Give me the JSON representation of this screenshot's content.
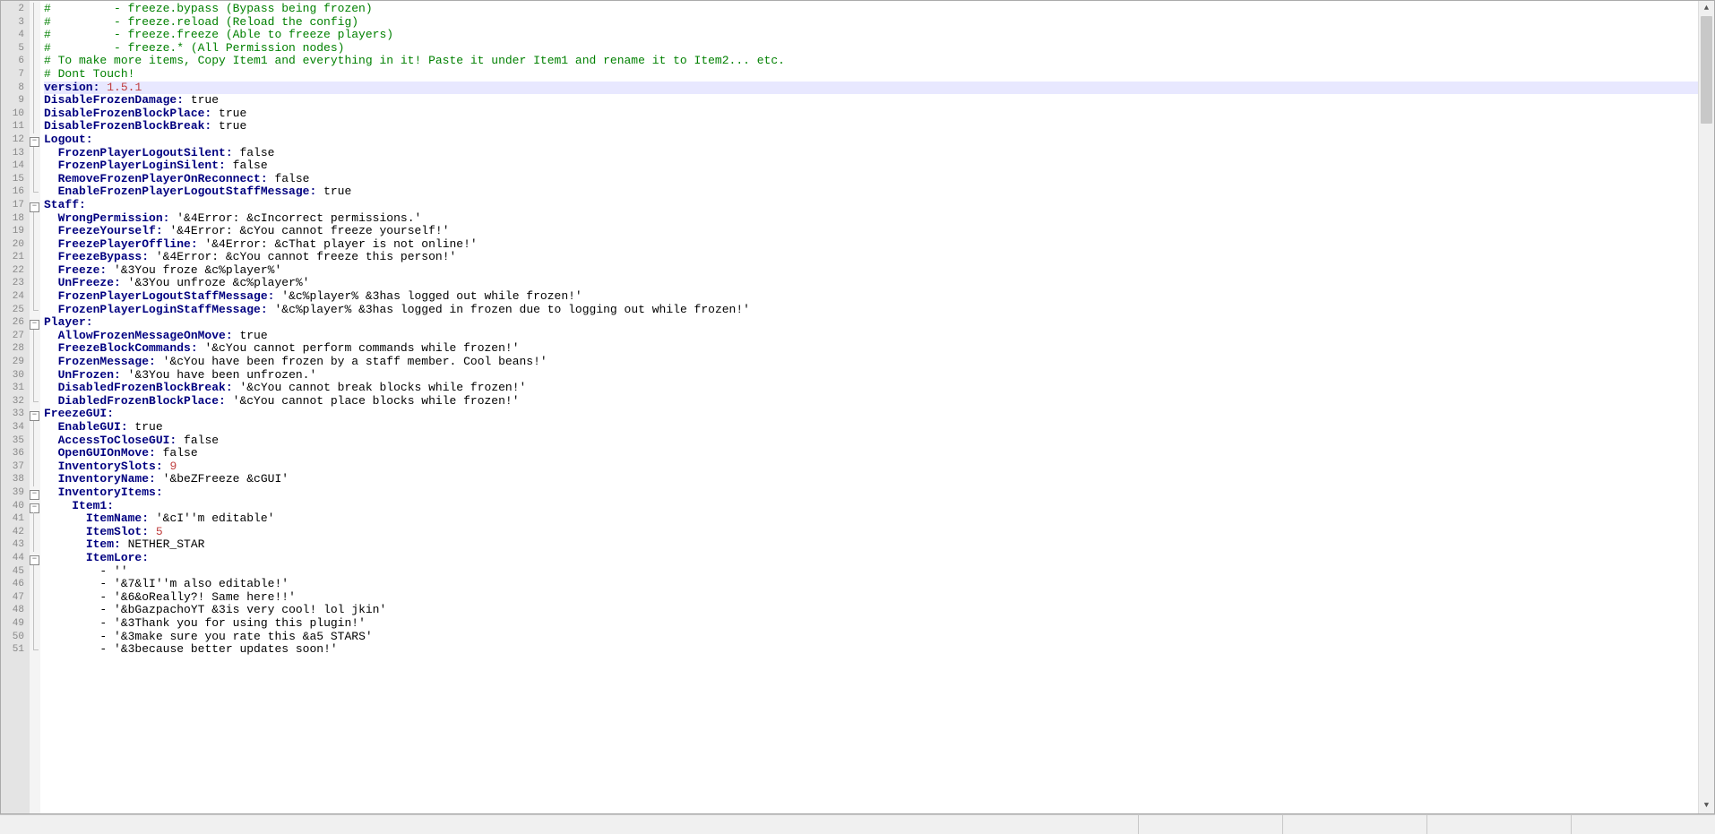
{
  "chart_data": null,
  "lines": [
    {
      "num": 2,
      "fold": "line",
      "segs": [
        {
          "cls": "c-comment",
          "t": "#         - freeze.bypass (Bypass being frozen)"
        }
      ]
    },
    {
      "num": 3,
      "fold": "line",
      "segs": [
        {
          "cls": "c-comment",
          "t": "#         - freeze.reload (Reload the config)"
        }
      ]
    },
    {
      "num": 4,
      "fold": "line",
      "segs": [
        {
          "cls": "c-comment",
          "t": "#         - freeze.freeze (Able to freeze players)"
        }
      ]
    },
    {
      "num": 5,
      "fold": "line",
      "segs": [
        {
          "cls": "c-comment",
          "t": "#         - freeze.* (All Permission nodes)"
        }
      ]
    },
    {
      "num": 6,
      "fold": "line",
      "segs": [
        {
          "cls": "c-comment",
          "t": "# To make more items, Copy Item1 and everything in it! Paste it under Item1 and rename it to Item2... etc."
        }
      ]
    },
    {
      "num": 7,
      "fold": "line",
      "segs": [
        {
          "cls": "c-comment",
          "t": "# Dont Touch!"
        }
      ]
    },
    {
      "num": 8,
      "fold": "line",
      "hl": true,
      "segs": [
        {
          "cls": "c-key",
          "t": "version:"
        },
        {
          "cls": "c-plain",
          "t": " "
        },
        {
          "cls": "c-num",
          "t": "1.5.1"
        }
      ]
    },
    {
      "num": 9,
      "fold": "line",
      "segs": [
        {
          "cls": "c-key",
          "t": "DisableFrozenDamage:"
        },
        {
          "cls": "c-plain",
          "t": " true"
        }
      ]
    },
    {
      "num": 10,
      "fold": "line",
      "segs": [
        {
          "cls": "c-key",
          "t": "DisableFrozenBlockPlace:"
        },
        {
          "cls": "c-plain",
          "t": " true"
        }
      ]
    },
    {
      "num": 11,
      "fold": "line",
      "segs": [
        {
          "cls": "c-key",
          "t": "DisableFrozenBlockBreak:"
        },
        {
          "cls": "c-plain",
          "t": " true"
        }
      ]
    },
    {
      "num": 12,
      "fold": "open",
      "segs": [
        {
          "cls": "c-key",
          "t": "Logout:"
        }
      ]
    },
    {
      "num": 13,
      "fold": "line",
      "indent": 1,
      "segs": [
        {
          "cls": "c-key",
          "t": "FrozenPlayerLogoutSilent:"
        },
        {
          "cls": "c-plain",
          "t": " false"
        }
      ]
    },
    {
      "num": 14,
      "fold": "line",
      "indent": 1,
      "segs": [
        {
          "cls": "c-key",
          "t": "FrozenPlayerLoginSilent:"
        },
        {
          "cls": "c-plain",
          "t": " false"
        }
      ]
    },
    {
      "num": 15,
      "fold": "line",
      "indent": 1,
      "segs": [
        {
          "cls": "c-key",
          "t": "RemoveFrozenPlayerOnReconnect:"
        },
        {
          "cls": "c-plain",
          "t": " false"
        }
      ]
    },
    {
      "num": 16,
      "fold": "end",
      "indent": 1,
      "segs": [
        {
          "cls": "c-key",
          "t": "EnableFrozenPlayerLogoutStaffMessage:"
        },
        {
          "cls": "c-plain",
          "t": " true"
        }
      ]
    },
    {
      "num": 17,
      "fold": "open",
      "segs": [
        {
          "cls": "c-key",
          "t": "Staff:"
        }
      ]
    },
    {
      "num": 18,
      "fold": "line",
      "indent": 1,
      "segs": [
        {
          "cls": "c-key",
          "t": "WrongPermission:"
        },
        {
          "cls": "c-plain",
          "t": " "
        },
        {
          "cls": "c-str",
          "t": "'&4Error: &cIncorrect permissions.'"
        }
      ]
    },
    {
      "num": 19,
      "fold": "line",
      "indent": 1,
      "segs": [
        {
          "cls": "c-key",
          "t": "FreezeYourself:"
        },
        {
          "cls": "c-plain",
          "t": " "
        },
        {
          "cls": "c-str",
          "t": "'&4Error: &cYou cannot freeze yourself!'"
        }
      ]
    },
    {
      "num": 20,
      "fold": "line",
      "indent": 1,
      "segs": [
        {
          "cls": "c-key",
          "t": "FreezePlayerOffline:"
        },
        {
          "cls": "c-plain",
          "t": " "
        },
        {
          "cls": "c-str",
          "t": "'&4Error: &cThat player is not online!'"
        }
      ]
    },
    {
      "num": 21,
      "fold": "line",
      "indent": 1,
      "segs": [
        {
          "cls": "c-key",
          "t": "FreezeBypass:"
        },
        {
          "cls": "c-plain",
          "t": " "
        },
        {
          "cls": "c-str",
          "t": "'&4Error: &cYou cannot freeze this person!'"
        }
      ]
    },
    {
      "num": 22,
      "fold": "line",
      "indent": 1,
      "segs": [
        {
          "cls": "c-key",
          "t": "Freeze:"
        },
        {
          "cls": "c-plain",
          "t": " "
        },
        {
          "cls": "c-str",
          "t": "'&3You froze &c%player%'"
        }
      ]
    },
    {
      "num": 23,
      "fold": "line",
      "indent": 1,
      "segs": [
        {
          "cls": "c-key",
          "t": "UnFreeze:"
        },
        {
          "cls": "c-plain",
          "t": " "
        },
        {
          "cls": "c-str",
          "t": "'&3You unfroze &c%player%'"
        }
      ]
    },
    {
      "num": 24,
      "fold": "line",
      "indent": 1,
      "segs": [
        {
          "cls": "c-key",
          "t": "FrozenPlayerLogoutStaffMessage:"
        },
        {
          "cls": "c-plain",
          "t": " "
        },
        {
          "cls": "c-str",
          "t": "'&c%player% &3has logged out while frozen!'"
        }
      ]
    },
    {
      "num": 25,
      "fold": "end",
      "indent": 1,
      "segs": [
        {
          "cls": "c-key",
          "t": "FrozenPlayerLoginStaffMessage:"
        },
        {
          "cls": "c-plain",
          "t": " "
        },
        {
          "cls": "c-str",
          "t": "'&c%player% &3has logged in frozen due to logging out while frozen!'"
        }
      ]
    },
    {
      "num": 26,
      "fold": "open",
      "segs": [
        {
          "cls": "c-key",
          "t": "Player:"
        }
      ]
    },
    {
      "num": 27,
      "fold": "line",
      "indent": 1,
      "segs": [
        {
          "cls": "c-key",
          "t": "AllowFrozenMessageOnMove:"
        },
        {
          "cls": "c-plain",
          "t": " true"
        }
      ]
    },
    {
      "num": 28,
      "fold": "line",
      "indent": 1,
      "segs": [
        {
          "cls": "c-key",
          "t": "FreezeBlockCommands:"
        },
        {
          "cls": "c-plain",
          "t": " "
        },
        {
          "cls": "c-str",
          "t": "'&cYou cannot perform commands while frozen!'"
        }
      ]
    },
    {
      "num": 29,
      "fold": "line",
      "indent": 1,
      "segs": [
        {
          "cls": "c-key",
          "t": "FrozenMessage:"
        },
        {
          "cls": "c-plain",
          "t": " "
        },
        {
          "cls": "c-str",
          "t": "'&cYou have been frozen by a staff member. Cool beans!'"
        }
      ]
    },
    {
      "num": 30,
      "fold": "line",
      "indent": 1,
      "segs": [
        {
          "cls": "c-key",
          "t": "UnFrozen:"
        },
        {
          "cls": "c-plain",
          "t": " "
        },
        {
          "cls": "c-str",
          "t": "'&3You have been unfrozen.'"
        }
      ]
    },
    {
      "num": 31,
      "fold": "line",
      "indent": 1,
      "segs": [
        {
          "cls": "c-key",
          "t": "DisabledFrozenBlockBreak:"
        },
        {
          "cls": "c-plain",
          "t": " "
        },
        {
          "cls": "c-str",
          "t": "'&cYou cannot break blocks while frozen!'"
        }
      ]
    },
    {
      "num": 32,
      "fold": "end",
      "indent": 1,
      "segs": [
        {
          "cls": "c-key",
          "t": "DiabledFrozenBlockPlace:"
        },
        {
          "cls": "c-plain",
          "t": " "
        },
        {
          "cls": "c-str",
          "t": "'&cYou cannot place blocks while frozen!'"
        }
      ]
    },
    {
      "num": 33,
      "fold": "open",
      "segs": [
        {
          "cls": "c-key",
          "t": "FreezeGUI:"
        }
      ]
    },
    {
      "num": 34,
      "fold": "line",
      "indent": 1,
      "segs": [
        {
          "cls": "c-key",
          "t": "EnableGUI:"
        },
        {
          "cls": "c-plain",
          "t": " true"
        }
      ]
    },
    {
      "num": 35,
      "fold": "line",
      "indent": 1,
      "segs": [
        {
          "cls": "c-key",
          "t": "AccessToCloseGUI:"
        },
        {
          "cls": "c-plain",
          "t": " false"
        }
      ]
    },
    {
      "num": 36,
      "fold": "line",
      "indent": 1,
      "segs": [
        {
          "cls": "c-key",
          "t": "OpenGUIOnMove:"
        },
        {
          "cls": "c-plain",
          "t": " false"
        }
      ]
    },
    {
      "num": 37,
      "fold": "line",
      "indent": 1,
      "segs": [
        {
          "cls": "c-key",
          "t": "InventorySlots:"
        },
        {
          "cls": "c-plain",
          "t": " "
        },
        {
          "cls": "c-num",
          "t": "9"
        }
      ]
    },
    {
      "num": 38,
      "fold": "line",
      "indent": 1,
      "segs": [
        {
          "cls": "c-key",
          "t": "InventoryName:"
        },
        {
          "cls": "c-plain",
          "t": " "
        },
        {
          "cls": "c-str",
          "t": "'&beZFreeze &cGUI'"
        }
      ]
    },
    {
      "num": 39,
      "fold": "open",
      "indent": 1,
      "segs": [
        {
          "cls": "c-key",
          "t": "InventoryItems:"
        }
      ]
    },
    {
      "num": 40,
      "fold": "open",
      "indent": 2,
      "segs": [
        {
          "cls": "c-key",
          "t": "Item1:"
        }
      ]
    },
    {
      "num": 41,
      "fold": "line",
      "indent": 3,
      "segs": [
        {
          "cls": "c-key",
          "t": "ItemName:"
        },
        {
          "cls": "c-plain",
          "t": " "
        },
        {
          "cls": "c-str",
          "t": "'&cI''m editable'"
        }
      ]
    },
    {
      "num": 42,
      "fold": "line",
      "indent": 3,
      "segs": [
        {
          "cls": "c-key",
          "t": "ItemSlot:"
        },
        {
          "cls": "c-plain",
          "t": " "
        },
        {
          "cls": "c-num",
          "t": "5"
        }
      ]
    },
    {
      "num": 43,
      "fold": "line",
      "indent": 3,
      "segs": [
        {
          "cls": "c-key",
          "t": "Item:"
        },
        {
          "cls": "c-plain",
          "t": " NETHER_STAR"
        }
      ]
    },
    {
      "num": 44,
      "fold": "open",
      "indent": 3,
      "segs": [
        {
          "cls": "c-key",
          "t": "ItemLore:"
        }
      ]
    },
    {
      "num": 45,
      "fold": "line",
      "indent": 4,
      "segs": [
        {
          "cls": "c-plain",
          "t": "- "
        },
        {
          "cls": "c-str",
          "t": "''"
        }
      ]
    },
    {
      "num": 46,
      "fold": "line",
      "indent": 4,
      "segs": [
        {
          "cls": "c-plain",
          "t": "- "
        },
        {
          "cls": "c-str",
          "t": "'&7&lI''m also editable!'"
        }
      ]
    },
    {
      "num": 47,
      "fold": "line",
      "indent": 4,
      "segs": [
        {
          "cls": "c-plain",
          "t": "- "
        },
        {
          "cls": "c-str",
          "t": "'&6&oReally?! Same here!!'"
        }
      ]
    },
    {
      "num": 48,
      "fold": "line",
      "indent": 4,
      "segs": [
        {
          "cls": "c-plain",
          "t": "- "
        },
        {
          "cls": "c-str",
          "t": "'&bGazpachoYT &3is very cool! lol jkin'"
        }
      ]
    },
    {
      "num": 49,
      "fold": "line",
      "indent": 4,
      "segs": [
        {
          "cls": "c-plain",
          "t": "- "
        },
        {
          "cls": "c-str",
          "t": "'&3Thank you for using this plugin!'"
        }
      ]
    },
    {
      "num": 50,
      "fold": "line",
      "indent": 4,
      "segs": [
        {
          "cls": "c-plain",
          "t": "- "
        },
        {
          "cls": "c-str",
          "t": "'&3make sure you rate this &a5 STARS'"
        }
      ]
    },
    {
      "num": 51,
      "fold": "end",
      "indent": 4,
      "segs": [
        {
          "cls": "c-plain",
          "t": "- "
        },
        {
          "cls": "c-str",
          "t": "'&3because better updates soon!'"
        }
      ]
    }
  ],
  "scroll": {
    "up": "▲",
    "down": "▼"
  }
}
